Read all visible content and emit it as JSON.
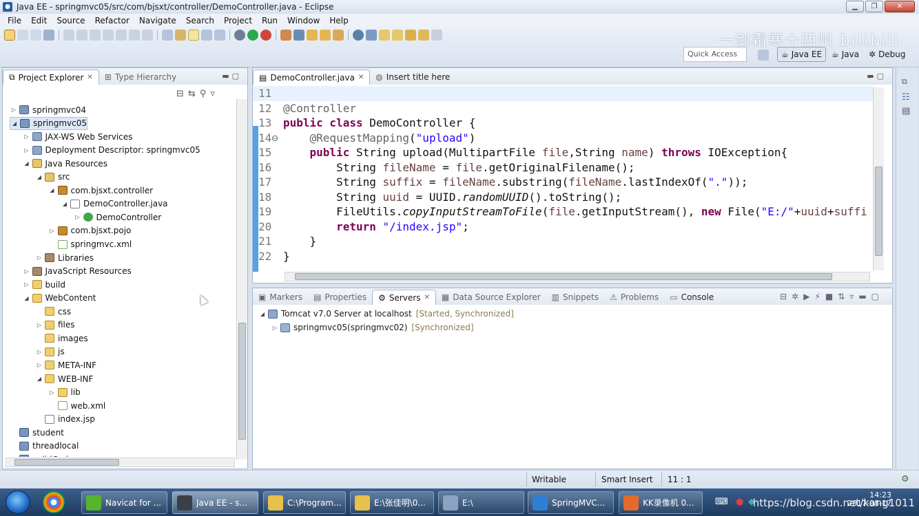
{
  "window": {
    "title": "Java EE - springmvc05/src/com/bjsxt/controller/DemoController.java - Eclipse"
  },
  "watermark": "一剑霜寒十四州 bilibili",
  "menu": [
    "File",
    "Edit",
    "Source",
    "Refactor",
    "Navigate",
    "Search",
    "Project",
    "Run",
    "Window",
    "Help"
  ],
  "toolbar": {
    "quick_access": "Quick Access",
    "perspectives": [
      "Java EE",
      "Java",
      "Debug"
    ],
    "active_perspective": "Java EE"
  },
  "explorer": {
    "tabs": [
      "Project Explorer",
      "Type Hierarchy"
    ],
    "active_tab": "Project Explorer",
    "tree": [
      {
        "label": "springmvc04",
        "level": 0,
        "twisty": "▷",
        "icon": "proj"
      },
      {
        "label": "springmvc05",
        "level": 0,
        "twisty": "◢",
        "icon": "proj",
        "selected": true
      },
      {
        "label": "JAX-WS Web Services",
        "level": 1,
        "twisty": "▷",
        "icon": "ws"
      },
      {
        "label": "Deployment Descriptor: springmvc05",
        "level": 1,
        "twisty": "▷",
        "icon": "ws"
      },
      {
        "label": "Java Resources",
        "level": 1,
        "twisty": "◢",
        "icon": "src"
      },
      {
        "label": "src",
        "level": 2,
        "twisty": "◢",
        "icon": "src"
      },
      {
        "label": "com.bjsxt.controller",
        "level": 3,
        "twisty": "◢",
        "icon": "pkg"
      },
      {
        "label": "DemoController.java",
        "level": 4,
        "twisty": "◢",
        "icon": "jfile"
      },
      {
        "label": "DemoController",
        "level": 5,
        "twisty": "▷",
        "icon": "cls"
      },
      {
        "label": "com.bjsxt.pojo",
        "level": 3,
        "twisty": "▷",
        "icon": "pkg"
      },
      {
        "label": "springmvc.xml",
        "level": 3,
        "twisty": "",
        "icon": "xml"
      },
      {
        "label": "Libraries",
        "level": 2,
        "twisty": "▷",
        "icon": "lib"
      },
      {
        "label": "JavaScript Resources",
        "level": 1,
        "twisty": "▷",
        "icon": "lib"
      },
      {
        "label": "build",
        "level": 1,
        "twisty": "▷",
        "icon": "folder"
      },
      {
        "label": "WebContent",
        "level": 1,
        "twisty": "◢",
        "icon": "folder"
      },
      {
        "label": "css",
        "level": 2,
        "twisty": "",
        "icon": "folder"
      },
      {
        "label": "files",
        "level": 2,
        "twisty": "▷",
        "icon": "folder"
      },
      {
        "label": "images",
        "level": 2,
        "twisty": "",
        "icon": "folder"
      },
      {
        "label": "js",
        "level": 2,
        "twisty": "▷",
        "icon": "folder"
      },
      {
        "label": "META-INF",
        "level": 2,
        "twisty": "▷",
        "icon": "folder"
      },
      {
        "label": "WEB-INF",
        "level": 2,
        "twisty": "◢",
        "icon": "folder"
      },
      {
        "label": "lib",
        "level": 3,
        "twisty": "▷",
        "icon": "folder"
      },
      {
        "label": "web.xml",
        "level": 3,
        "twisty": "",
        "icon": "xml"
      },
      {
        "label": "index.jsp",
        "level": 2,
        "twisty": "",
        "icon": "jfile"
      },
      {
        "label": "student",
        "level": 0,
        "twisty": "",
        "icon": "proj"
      },
      {
        "label": "threadlocal",
        "level": 0,
        "twisty": "",
        "icon": "proj"
      },
      {
        "label": "validCode",
        "level": 0,
        "twisty": "",
        "icon": "proj"
      }
    ]
  },
  "editor": {
    "tabs": [
      "DemoController.java",
      "Insert title here"
    ],
    "active_tab": "DemoController.java",
    "lines": [
      {
        "n": "11",
        "html": ""
      },
      {
        "n": "12",
        "html": "<span class=\"a\">@Controller</span>"
      },
      {
        "n": "13",
        "html": "<span class=\"k\">public class</span> DemoController {"
      },
      {
        "n": "14⊖",
        "html": "    <span class=\"a\">@RequestMapping</span>(<span class=\"s\">\"upload\"</span>)"
      },
      {
        "n": "15",
        "html": "    <span class=\"k\">public</span> String upload(MultipartFile <span class=\"p\">file</span>,String <span class=\"p\">name</span>) <span class=\"k\">throws</span> IOException{"
      },
      {
        "n": "16",
        "html": "        String <span class=\"p\">fileName</span> = <span class=\"p\">file</span>.getOriginalFilename();"
      },
      {
        "n": "17",
        "html": "        String <span class=\"p\">suffix</span> = <span class=\"p\">fileName</span>.substring(<span class=\"p\">fileName</span>.lastIndexOf(<span class=\"s\">\".\"</span>));"
      },
      {
        "n": "18",
        "html": "        String <span class=\"p\">uuid</span> = UUID.<span class=\"it\">randomUUID</span>().toString();"
      },
      {
        "n": "19",
        "html": "        FileUtils.<span class=\"it\">copyInputStreamToFile</span>(<span class=\"p\">file</span>.getInputStream(), <span class=\"k\">new</span> File(<span class=\"s\">\"E:/\"</span>+<span class=\"p\">uuid</span>+<span class=\"p\">suffi</span>"
      },
      {
        "n": "20",
        "html": "        <span class=\"k\">return</span> <span class=\"s\">\"/index.jsp\"</span>;"
      },
      {
        "n": "21",
        "html": "    }"
      },
      {
        "n": "22",
        "html": "}"
      }
    ]
  },
  "bottom": {
    "tabs": [
      "Markers",
      "Properties",
      "Servers",
      "Data Source Explorer",
      "Snippets",
      "Problems",
      "Console"
    ],
    "active_tab": "Servers",
    "server": {
      "name": "Tomcat v7.0 Server at localhost",
      "state": "[Started, Synchronized]"
    },
    "module": {
      "name": "springmvc05(springmvc02)",
      "state": "[Synchronized]"
    }
  },
  "status": {
    "mode": "Writable",
    "insert": "Smart Insert",
    "position": "11 : 1"
  },
  "taskbar": {
    "tasks": [
      "Navicat for ...",
      "Java EE - s...",
      "C:\\Program...",
      "E:\\张佳明\\0...",
      "E:\\",
      "SpringMVC...",
      "KK录像机 0..."
    ],
    "active_task": "Java EE - s...",
    "blog_url": "https://blog.csdn.net/kang1011",
    "time": "14:23",
    "date": "2017-08-17"
  },
  "colors": {
    "keyword": "#7f0055",
    "string": "#2a00ff",
    "annotation": "#646464",
    "param": "#6a3e3e"
  }
}
